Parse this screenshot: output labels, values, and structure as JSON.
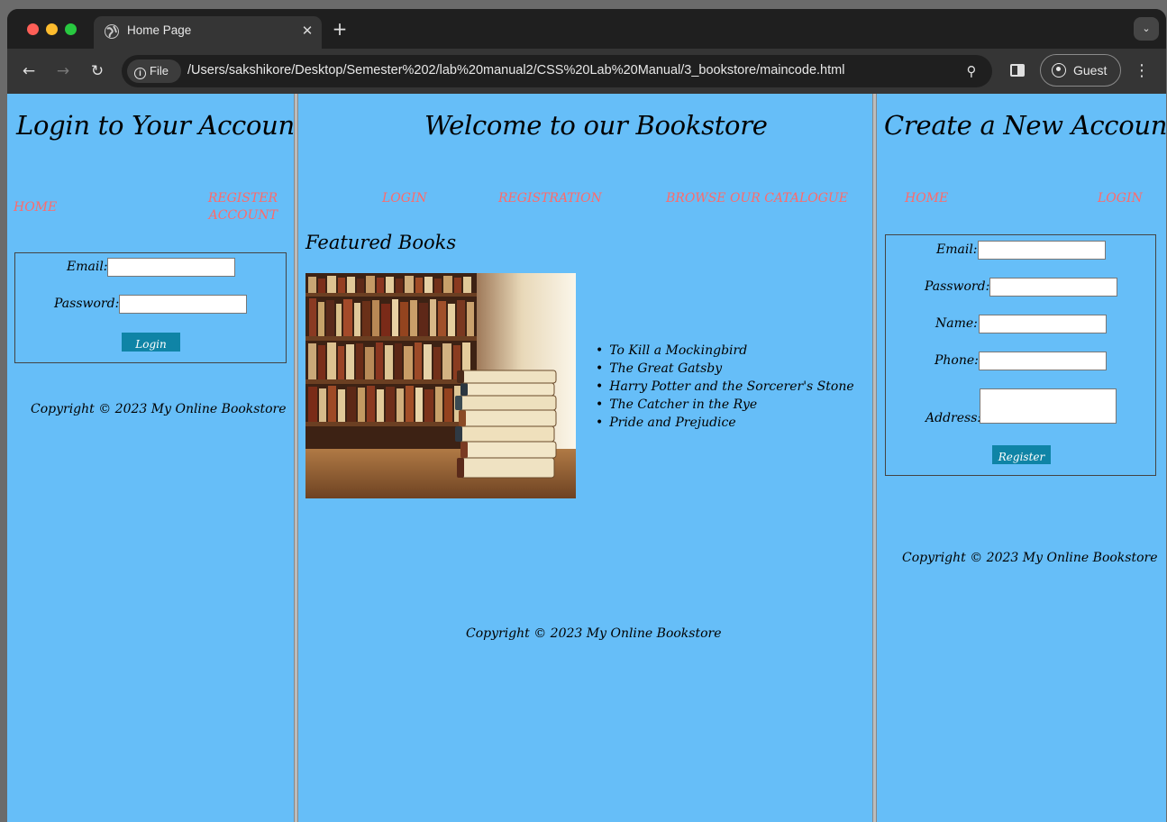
{
  "browser": {
    "tab_title": "Home Page",
    "tab_close": "✕",
    "new_tab": "+",
    "tab_menu": "⌄",
    "chip_label": "File",
    "url": "/Users/sakshikore/Desktop/Semester%202/lab%20manual2/CSS%20Lab%20Manual/3_bookstore/maincode.html",
    "profile_label": "Guest",
    "back": "←",
    "forward": "→",
    "reload": "↻",
    "zoom": "⚲",
    "menu": "⋮"
  },
  "left_frame": {
    "title": "Login to Your Account",
    "nav": [
      "HOME",
      "REGISTER ACCOUNT"
    ],
    "form": {
      "email_label": "Email:",
      "email_value": "",
      "password_label": "Password:",
      "password_value": "",
      "submit_label": "Login"
    },
    "copyright": "Copyright © 2023 My Online Bookstore"
  },
  "main_frame": {
    "title": "Welcome to our Bookstore",
    "nav": [
      "LOGIN",
      "REGISTRATION",
      "BROWSE OUR CATALOGUE"
    ],
    "featured_heading": "Featured Books",
    "books": [
      "To Kill a Mockingbird",
      "The Great Gatsby",
      "Harry Potter and the Sorcerer's Stone",
      "The Catcher in the Rye",
      "Pride and Prejudice"
    ],
    "copyright": "Copyright © 2023 My Online Bookstore"
  },
  "right_frame": {
    "title": "Create a New Account",
    "nav": [
      "HOME",
      "LOGIN"
    ],
    "form": {
      "email_label": "Email:",
      "password_label": "Password:",
      "name_label": "Name:",
      "phone_label": "Phone:",
      "address_label": "Address:",
      "submit_label": "Register"
    },
    "copyright": "Copyright © 2023 My Online Bookstore"
  },
  "colors": {
    "page_bg": "#66bef8",
    "link": "#ff6a6a",
    "button": "#0f84a6"
  }
}
